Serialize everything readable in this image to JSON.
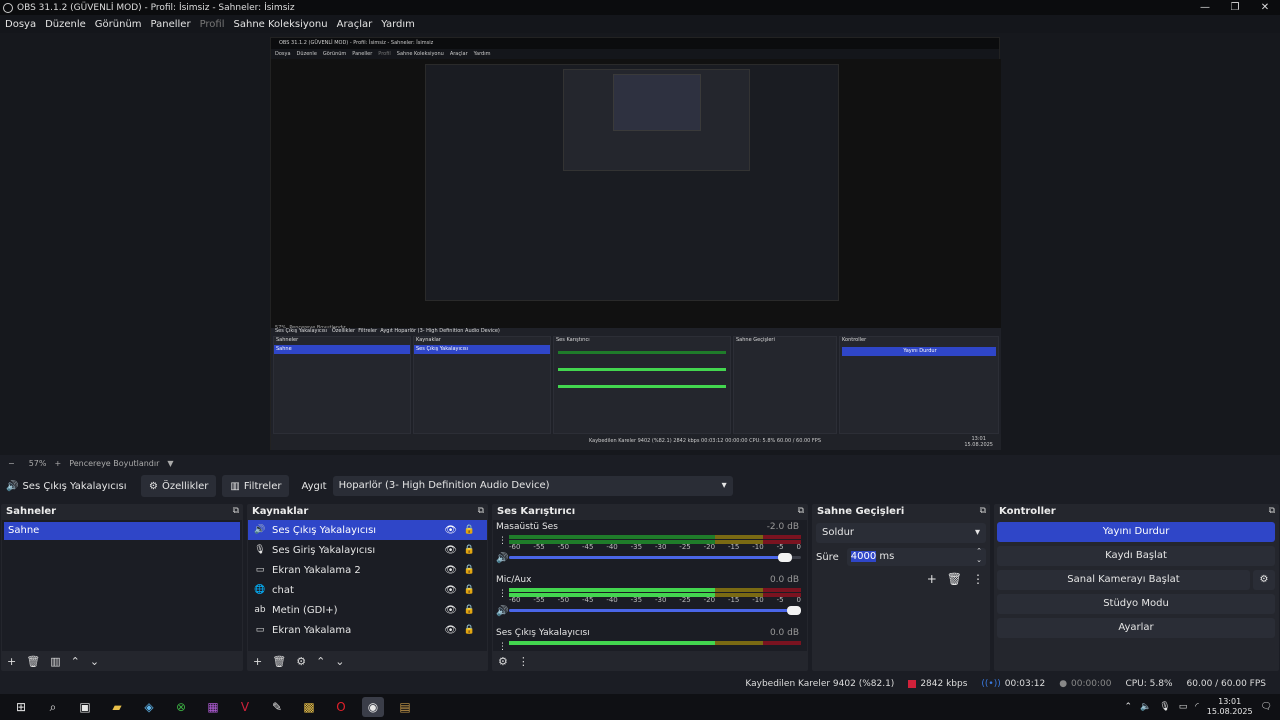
{
  "window": {
    "title": "OBS 31.1.2 (GÜVENLİ MOD) - Profil: İsimsiz - Sahneler: İsimsiz",
    "minimize": "—",
    "restore": "❐",
    "close": "✕"
  },
  "menu": {
    "items": [
      "Dosya",
      "Düzenle",
      "Görünüm",
      "Paneller",
      "Profil",
      "Sahne Koleksiyonu",
      "Araçlar",
      "Yardım"
    ]
  },
  "zoom": {
    "minus": "−",
    "percent": "57%",
    "plus": "+",
    "fit_label": "Pencereye Boyutlandır",
    "caret": "▼"
  },
  "source_bar": {
    "source_name": "Ses Çıkış Yakalayıcısı",
    "properties_label": "Özellikler",
    "filters_label": "Filtreler",
    "device_label": "Aygıt",
    "device_value": "Hoparlör (3- High Definition Audio Device)"
  },
  "scenes": {
    "title": "Sahneler",
    "items": [
      "Sahne"
    ]
  },
  "sources": {
    "title": "Kaynaklar",
    "items": [
      {
        "label": "Ses Çıkış Yakalayıcısı",
        "icon": "speaker-icon",
        "selected": true
      },
      {
        "label": "Ses Giriş Yakalayıcısı",
        "icon": "microphone-icon",
        "selected": false
      },
      {
        "label": "Ekran Yakalama 2",
        "icon": "monitor-icon",
        "selected": false
      },
      {
        "label": "chat",
        "icon": "globe-icon",
        "selected": false
      },
      {
        "label": "Metin (GDI+)",
        "icon": "text-icon",
        "selected": false
      },
      {
        "label": "Ekran Yakalama",
        "icon": "monitor-icon",
        "selected": false
      }
    ]
  },
  "mixer": {
    "title": "Ses Karıştırıcı",
    "ticks": [
      "-60",
      "-55",
      "-50",
      "-45",
      "-40",
      "-35",
      "-30",
      "-25",
      "-20",
      "-15",
      "-10",
      "-5",
      "0"
    ],
    "channels": [
      {
        "name": "Masaüstü Ses",
        "db": "-2.0 dB",
        "volume": 0.97
      },
      {
        "name": "Mic/Aux",
        "db": "0.0 dB",
        "volume": 1.0
      },
      {
        "name": "Ses Çıkış Yakalayıcısı",
        "db": "0.0 dB",
        "volume": 1.0
      }
    ]
  },
  "transitions": {
    "title": "Sahne Geçişleri",
    "type": "Soldur",
    "duration_label": "Süre",
    "duration_value": "4000",
    "duration_unit": "ms"
  },
  "controls": {
    "title": "Kontroller",
    "buttons": [
      "Yayını Durdur",
      "Kaydı Başlat",
      "Sanal Kamerayı Başlat",
      "Stüdyo Modu",
      "Ayarlar"
    ]
  },
  "status": {
    "dropped_frames": "Kaybedilen Kareler 9402 (%82.1)",
    "bitrate": "2842 kbps",
    "stream_time": "00:03:12",
    "rec_time": "00:00:00",
    "cpu": "CPU: 5.8%",
    "fps": "60.00 / 60.00 FPS",
    "colors": {
      "bitrate": "#d0213a",
      "stream": "#3a7ae0",
      "rec": "#777777"
    }
  },
  "nested": {
    "title": "OBS 31.1.2 (GÜVENLİ MOD) - Profil: İsimsiz - Sahneler: İsimsiz",
    "menu": [
      "Dosya",
      "Düzenle",
      "Görünüm",
      "Paneller",
      "Profil",
      "Sahne Koleksiyonu",
      "Araçlar",
      "Yardım"
    ],
    "zoom": "57%",
    "fit_label": "Pencereye Boyutlandır",
    "source_name": "Ses Çıkış Yakalayıcısı",
    "properties": "Özellikler",
    "filters": "Filtreler",
    "device_label": "Aygıt",
    "device_value": "Hoparlör (3- High Definition Audio Device)",
    "panels": [
      "Sahneler",
      "Kaynaklar",
      "Ses Karıştırıcı",
      "Sahne Geçişleri",
      "Kontroller"
    ],
    "scene": "Sahne",
    "status_text": "Kaybedilen Kareler 9402 (%82.1)   2842 kbps   00:03:12   00:00:00   CPU: 5.8%   60.00 / 60.00 FPS",
    "clock_time": "13:01",
    "clock_date": "15.08.2025"
  },
  "taskbar": {
    "clock_time": "13:01",
    "clock_date": "15.08.2025"
  }
}
